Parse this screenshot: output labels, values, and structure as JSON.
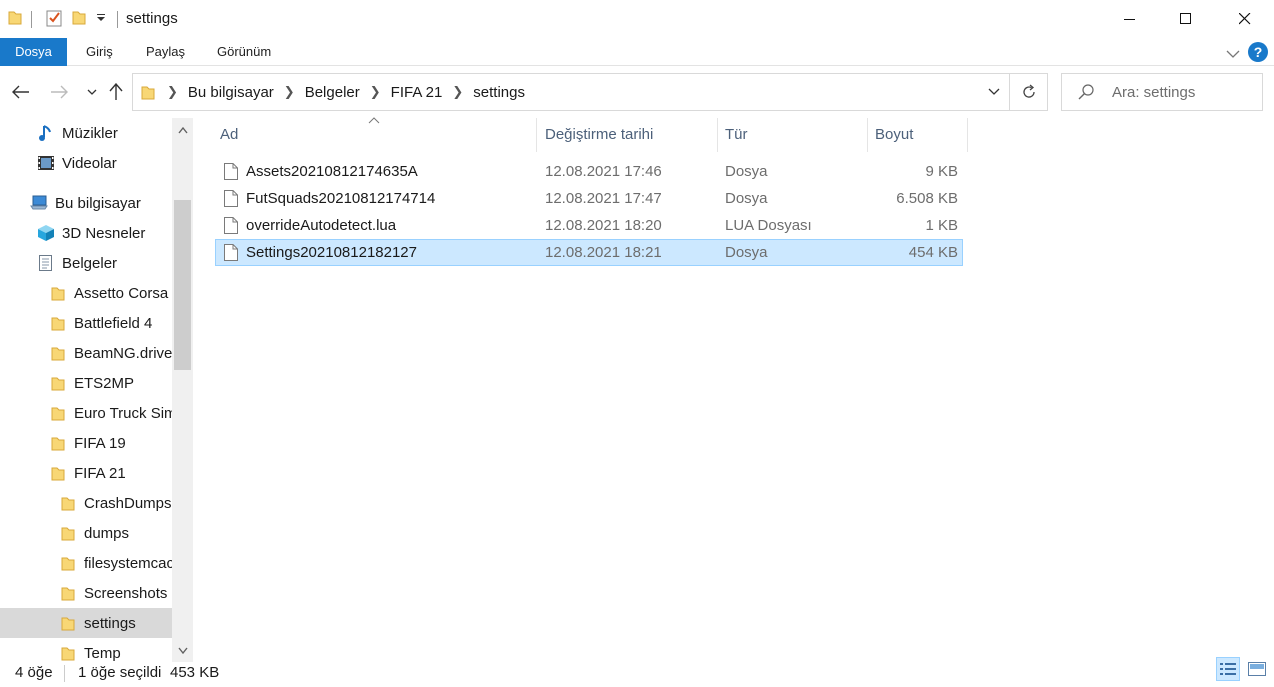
{
  "window": {
    "title": "settings",
    "controls": [
      "minimize",
      "maximize",
      "close"
    ]
  },
  "ribbon": {
    "tabs": [
      "Dosya",
      "Giriş",
      "Paylaş",
      "Görünüm"
    ],
    "help_label": "?"
  },
  "address": {
    "crumbs": [
      "Bu bilgisayar",
      "Belgeler",
      "FIFA 21",
      "settings"
    ],
    "search_placeholder": "Ara: settings"
  },
  "sidebar": {
    "items": [
      {
        "label": "Müzikler",
        "icon": "music-icon",
        "indent": 0
      },
      {
        "label": "Videolar",
        "icon": "video-icon",
        "indent": 0
      },
      {
        "label": "Bu bilgisayar",
        "icon": "computer-icon",
        "indent": -1
      },
      {
        "label": "3D Nesneler",
        "icon": "3d-objects-icon",
        "indent": 0
      },
      {
        "label": "Belgeler",
        "icon": "documents-icon",
        "indent": 0
      },
      {
        "label": "Assetto Corsa",
        "icon": "folder-icon",
        "indent": 1
      },
      {
        "label": "Battlefield 4",
        "icon": "folder-icon",
        "indent": 1
      },
      {
        "label": "BeamNG.drive",
        "icon": "folder-icon",
        "indent": 1
      },
      {
        "label": "ETS2MP",
        "icon": "folder-icon",
        "indent": 1
      },
      {
        "label": "Euro Truck Simu",
        "icon": "folder-icon",
        "indent": 1
      },
      {
        "label": "FIFA 19",
        "icon": "folder-icon",
        "indent": 1
      },
      {
        "label": "FIFA 21",
        "icon": "folder-icon",
        "indent": 1
      },
      {
        "label": "CrashDumps",
        "icon": "folder-icon",
        "indent": 2
      },
      {
        "label": "dumps",
        "icon": "folder-icon",
        "indent": 2
      },
      {
        "label": "filesystemcac",
        "icon": "folder-icon",
        "indent": 2
      },
      {
        "label": "Screenshots",
        "icon": "folder-icon",
        "indent": 2
      },
      {
        "label": "settings",
        "icon": "folder-icon",
        "indent": 2,
        "selected": true
      },
      {
        "label": "Temp",
        "icon": "folder-icon",
        "indent": 2
      }
    ]
  },
  "columns": {
    "name": "Ad",
    "modified": "Değiştirme tarihi",
    "type": "Tür",
    "size": "Boyut"
  },
  "files": [
    {
      "name": "Assets20210812174635A",
      "modified": "12.08.2021 17:46",
      "type": "Dosya",
      "size": "9 KB",
      "selected": false
    },
    {
      "name": "FutSquads20210812174714",
      "modified": "12.08.2021 17:47",
      "type": "Dosya",
      "size": "6.508 KB",
      "selected": false
    },
    {
      "name": "overrideAutodetect.lua",
      "modified": "12.08.2021 18:20",
      "type": "LUA Dosyası",
      "size": "1 KB",
      "selected": false
    },
    {
      "name": "Settings20210812182127",
      "modified": "12.08.2021 18:21",
      "type": "Dosya",
      "size": "454 KB",
      "selected": true
    }
  ],
  "status": {
    "item_count": "4 öğe",
    "selected": "1 öğe seçildi",
    "selected_size": "453 KB"
  },
  "colors": {
    "accent": "#1979ca",
    "selection_bg": "#cce8ff",
    "selection_border": "#99d1ff",
    "folder": "#f8d775"
  }
}
